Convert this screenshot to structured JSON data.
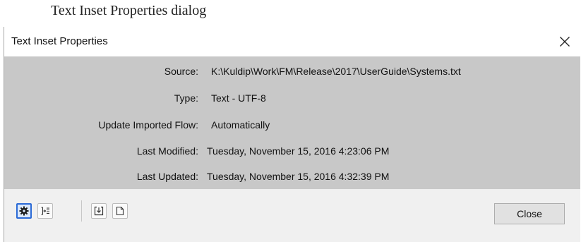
{
  "caption": "Text Inset Properties dialog",
  "dialog": {
    "title": "Text Inset Properties",
    "close_glyph": "×"
  },
  "properties": {
    "source": {
      "label": "Source:",
      "value": "K:\\Kuldip\\Work\\FM\\Release\\2017\\UserGuide\\Systems.txt"
    },
    "type": {
      "label": "Type:",
      "value": "Text - UTF-8"
    },
    "update_flow": {
      "label": "Update Imported Flow:",
      "value": "Automatically"
    },
    "last_modified": {
      "label": "Last Modified:",
      "value": "Tuesday, November 15, 2016 4:23:06 PM"
    },
    "last_updated": {
      "label": "Last Updated:",
      "value": "Tuesday, November 15, 2016 4:32:39 PM"
    }
  },
  "toolbar": {
    "icons": [
      "gear-icon",
      "import-icon",
      "update-icon",
      "document-icon"
    ],
    "selected": "gear-icon",
    "accent_color": "#2b6ad6"
  },
  "footer": {
    "close_label": "Close"
  }
}
